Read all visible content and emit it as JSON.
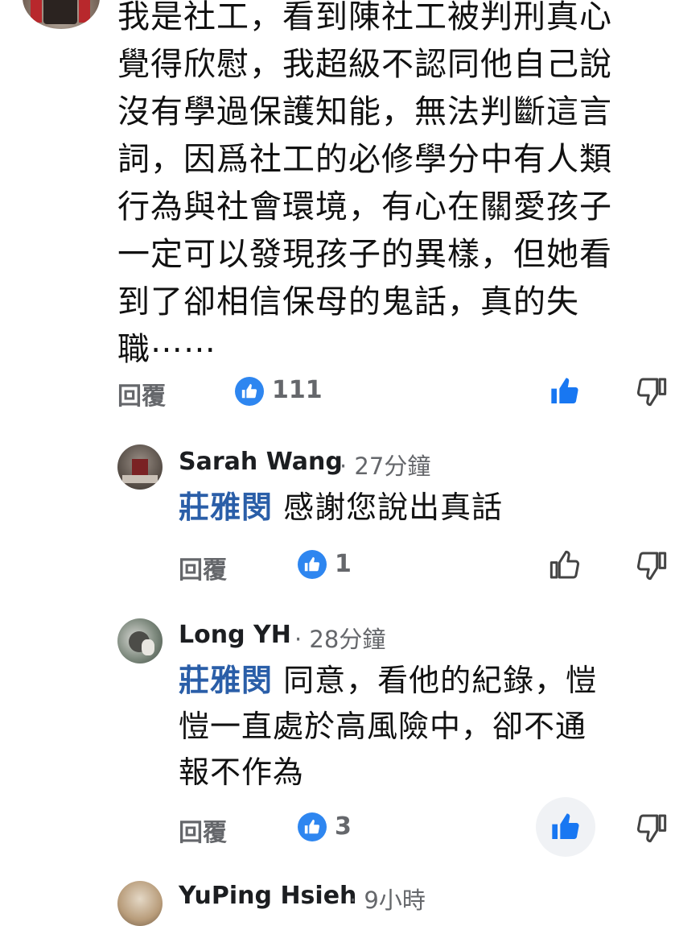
{
  "top_comment": {
    "text": "我是社工，看到陳社工被判刑真心\n覺得欣慰，我超級不認同他自己說\n沒有學過保護知能，無法判斷這言\n詞，因爲社工的必修學分中有人類\n行為與社會環境，有心在關愛孩子\n一定可以發現孩子的異樣，但她看\n到了卻相信保母的鬼話，真的失\n職⋯⋯",
    "reply_label": "回覆",
    "like_count": "111"
  },
  "replies": [
    {
      "author": "Sarah Wang",
      "time": "· 27分鐘",
      "mention": "莊雅閔",
      "text_lines": [
        "感謝您說出真話"
      ],
      "reply_label": "回覆",
      "like_count": "1"
    },
    {
      "author": "Long YH",
      "time": "· 28分鐘",
      "mention": "莊雅閔",
      "text_lines": [
        "同意，看他的紀錄，愷",
        "愷一直處於高風險中，卻不通",
        "報不作為"
      ],
      "reply_label": "回覆",
      "like_count": "3"
    },
    {
      "author": "YuPing Hsieh",
      "time": "· 9小時"
    }
  ],
  "colors": {
    "like_blue": "#2e86f0",
    "mention_blue": "#2a5ea8",
    "muted_gray": "#65676b"
  },
  "icons": [
    "like-icon",
    "dislike-icon",
    "like-badge-icon"
  ]
}
